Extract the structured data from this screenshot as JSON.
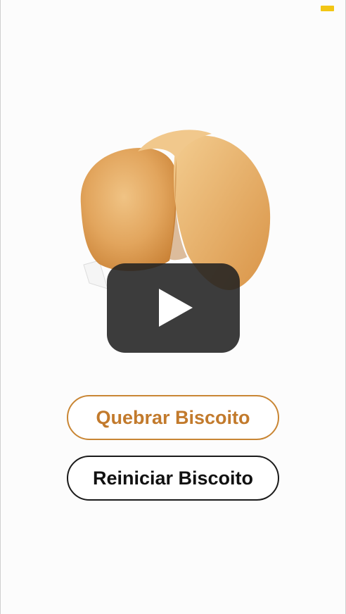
{
  "app": {
    "status_indicator": {
      "icon": "battery-indicator-icon",
      "color": "#f2c614"
    }
  },
  "media": {
    "image": "fortune-cookie",
    "overlay_icon": "play-icon"
  },
  "actions": {
    "break_label": "Quebrar Biscoito",
    "reset_label": "Reiniciar Biscoito"
  },
  "colors": {
    "accent": "#c27a2c",
    "accent_border": "#c98634",
    "dark": "#111111",
    "cookie": "#e3aa62"
  }
}
